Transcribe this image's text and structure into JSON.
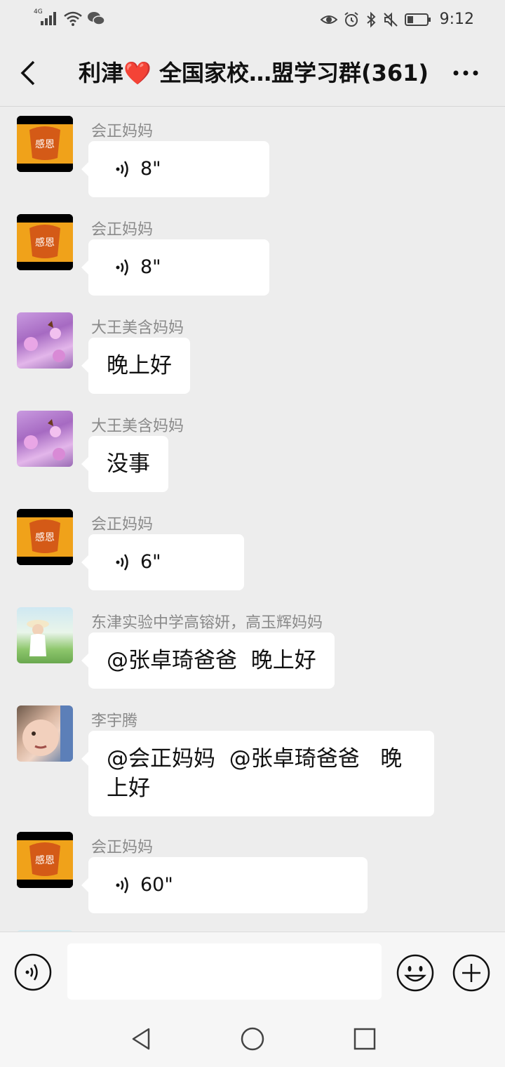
{
  "status_bar": {
    "network": "4G",
    "time": "9:12",
    "icons": [
      "signal-icon",
      "wifi-icon",
      "wechat-icon",
      "eye-icon",
      "alarm-icon",
      "bluetooth-icon",
      "mute-icon",
      "battery-icon"
    ]
  },
  "header": {
    "title_prefix": "利津",
    "title_heart": "❤️",
    "title_suffix": " 全国家校…盟学习群(361)"
  },
  "messages": [
    {
      "sender": "会正妈妈",
      "type": "voice",
      "duration": "8\""
    },
    {
      "sender": "会正妈妈",
      "type": "voice",
      "duration": "8\""
    },
    {
      "sender": "大王美含妈妈",
      "type": "text",
      "text": "晚上好"
    },
    {
      "sender": "大王美含妈妈",
      "type": "text",
      "text": "没事"
    },
    {
      "sender": "会正妈妈",
      "type": "voice",
      "duration": "6\""
    },
    {
      "sender": "东津实验中学高镕妍，高玉辉妈妈",
      "type": "text",
      "text": "@张卓琦爸爸  晚上好"
    },
    {
      "sender": "李宇腾",
      "type": "text",
      "text": "@会正妈妈  @张卓琦爸爸   晚上好"
    },
    {
      "sender": "会正妈妈",
      "type": "voice",
      "duration": "60\""
    }
  ],
  "input": {
    "value": "",
    "placeholder": ""
  },
  "colors": {
    "background": "#ededed",
    "bubble": "#ffffff",
    "heart": "#e0262b"
  }
}
